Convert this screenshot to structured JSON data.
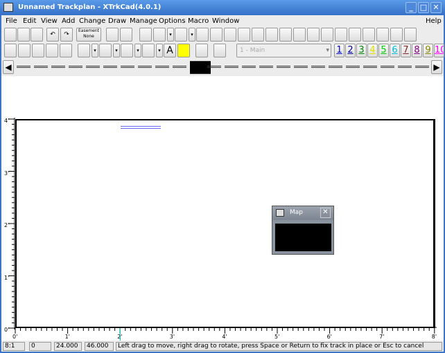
{
  "title": "Unnamed Trackplan - XTrkCad(4.0.1)",
  "window_buttons": {
    "minimize": "_",
    "maximize": "□",
    "close": "✕"
  },
  "menu": [
    "File",
    "Edit",
    "View",
    "Add",
    "Change",
    "Draw",
    "Manage",
    "Options",
    "Macro",
    "Window",
    "Help"
  ],
  "toolbar": {
    "easement_label": "Easement\nNone",
    "layer_select": "1 - Main",
    "layers": [
      {
        "n": "1",
        "c": "#0000cc"
      },
      {
        "n": "2",
        "c": "#000099"
      },
      {
        "n": "3",
        "c": "#008800"
      },
      {
        "n": "4",
        "c": "#e0e000"
      },
      {
        "n": "5",
        "c": "#00cc00"
      },
      {
        "n": "6",
        "c": "#00bbdd"
      },
      {
        "n": "7",
        "c": "#882222"
      },
      {
        "n": "8",
        "c": "#880088"
      },
      {
        "n": "9",
        "c": "#888800"
      },
      {
        "n": "10",
        "c": "#ff00ff"
      }
    ],
    "text_tool": "A"
  },
  "rulers": {
    "left": [
      "4'",
      "3'",
      "2'",
      "1'",
      "0'"
    ],
    "bottom": [
      "0'",
      "1'",
      "2'",
      "3'",
      "4'",
      "5'",
      "6'",
      "7'",
      "8'"
    ]
  },
  "map": {
    "title": "Map"
  },
  "status": {
    "scale": "8:1",
    "count": "0",
    "x": "24.000",
    "y": "46.000",
    "message": "Left drag to move, right drag to rotate, press Space or Return to fix track in place or Esc to cancel"
  }
}
